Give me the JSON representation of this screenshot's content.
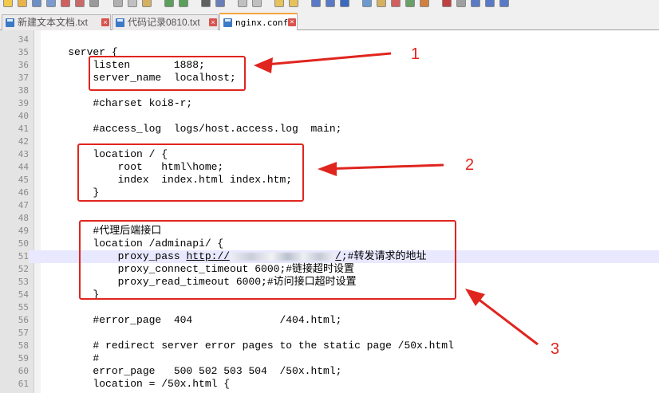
{
  "tabs": [
    {
      "label": "新建文本文档.txt",
      "active": false
    },
    {
      "label": "代码记录0810.txt",
      "active": false
    },
    {
      "label": "nginx.conf",
      "active": true
    }
  ],
  "editor": {
    "lines": [
      {
        "num": "34",
        "code": ""
      },
      {
        "num": "35",
        "code": "    server {"
      },
      {
        "num": "36",
        "code": "        listen       1888;"
      },
      {
        "num": "37",
        "code": "        server_name  localhost;"
      },
      {
        "num": "38",
        "code": ""
      },
      {
        "num": "39",
        "code": "        #charset koi8-r;"
      },
      {
        "num": "40",
        "code": ""
      },
      {
        "num": "41",
        "code": "        #access_log  logs/host.access.log  main;"
      },
      {
        "num": "42",
        "code": ""
      },
      {
        "num": "43",
        "code": "        location / {"
      },
      {
        "num": "44",
        "code": "            root   html\\home;"
      },
      {
        "num": "45",
        "code": "            index  index.html index.htm;"
      },
      {
        "num": "46",
        "code": "        }"
      },
      {
        "num": "47",
        "code": ""
      },
      {
        "num": "48",
        "code": ""
      },
      {
        "num": "49",
        "code": "        #代理后端接口"
      },
      {
        "num": "50",
        "code": "        location /adminapi/ {"
      },
      {
        "num": "51",
        "code": "            proxy_pass ",
        "url": "http://",
        "url_tail": "/",
        "comment": ";#转发请求的地址"
      },
      {
        "num": "52",
        "code": "            proxy_connect_timeout 6000;#链接超时设置"
      },
      {
        "num": "53",
        "code": "            proxy_read_timeout 6000;#访问接口超时设置"
      },
      {
        "num": "54",
        "code": "        }"
      },
      {
        "num": "55",
        "code": ""
      },
      {
        "num": "56",
        "code": "        #error_page  404              /404.html;"
      },
      {
        "num": "57",
        "code": ""
      },
      {
        "num": "58",
        "code": "        # redirect server error pages to the static page /50x.html"
      },
      {
        "num": "59",
        "code": "        #"
      },
      {
        "num": "60",
        "code": "        error_page   500 502 503 504  /50x.html;"
      },
      {
        "num": "61",
        "code": "        location = /50x.html {"
      }
    ],
    "current_line": "51"
  },
  "annotations": [
    {
      "label": "1"
    },
    {
      "label": "2"
    },
    {
      "label": "3"
    }
  ],
  "colors": {
    "annotation": "#e0251e",
    "active_tab_accent": "#f6a23b"
  }
}
